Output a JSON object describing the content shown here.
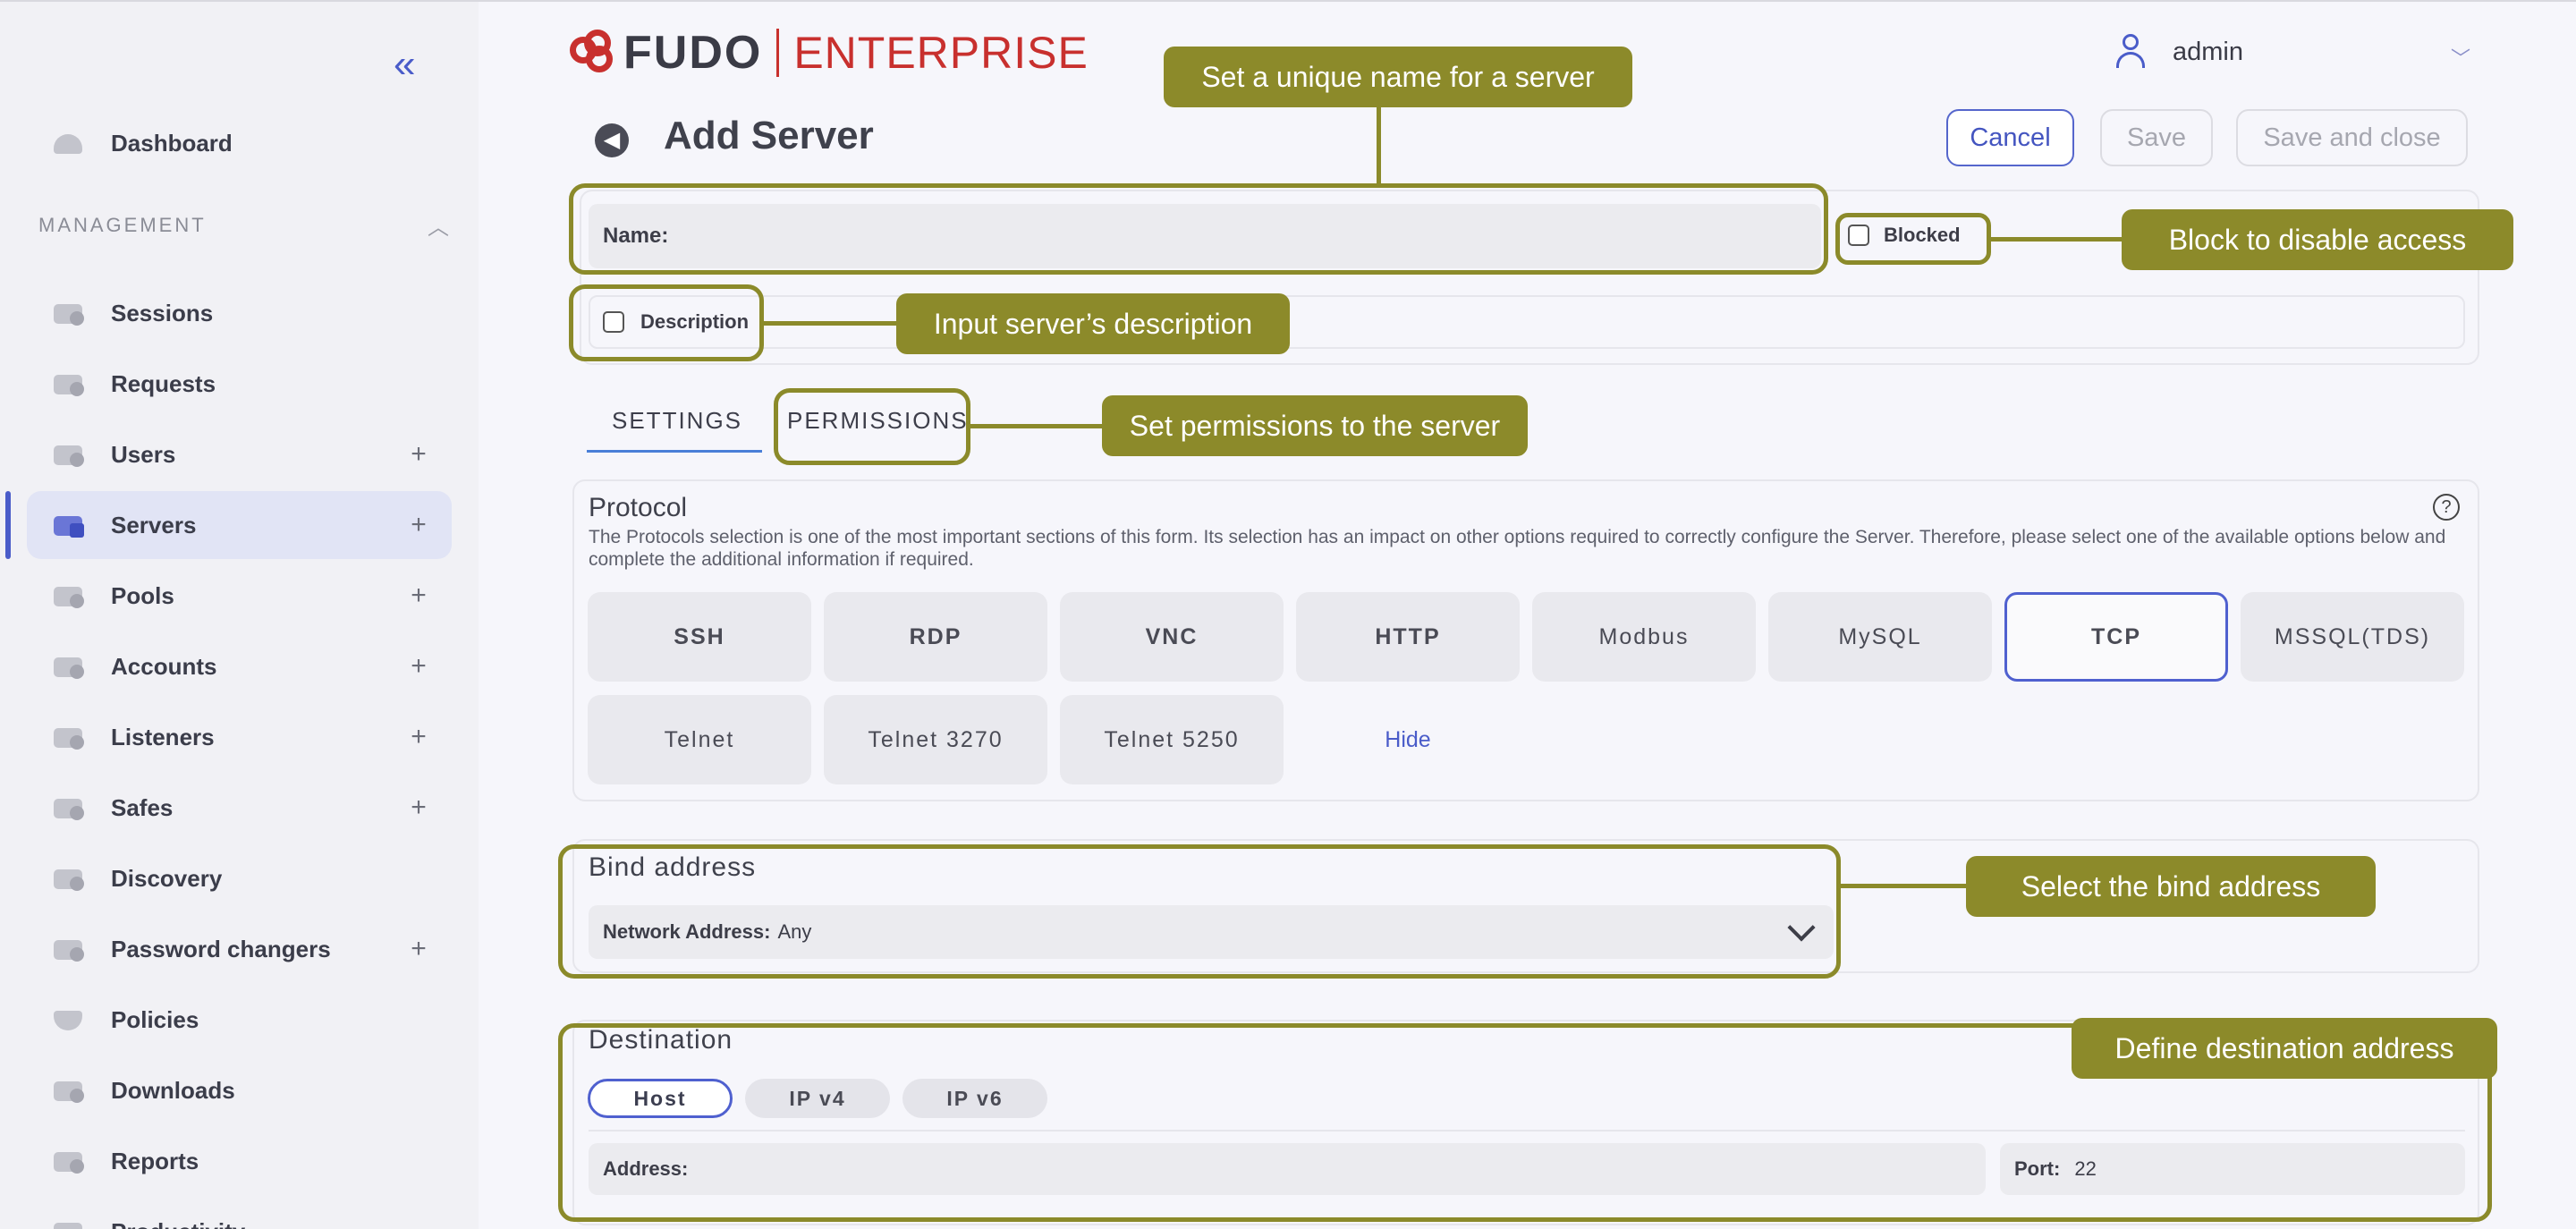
{
  "sidebar": {
    "collapse_icon": "double-chevron-left-icon",
    "dashboard": "Dashboard",
    "section_label": "MANAGEMENT",
    "items": [
      {
        "label": "Sessions",
        "icon": "sessions-icon",
        "add": ""
      },
      {
        "label": "Requests",
        "icon": "requests-icon",
        "add": ""
      },
      {
        "label": "Users",
        "icon": "users-icon",
        "add": "+"
      },
      {
        "label": "Servers",
        "icon": "servers-icon",
        "add": "+"
      },
      {
        "label": "Pools",
        "icon": "pools-icon",
        "add": "+"
      },
      {
        "label": "Accounts",
        "icon": "accounts-icon",
        "add": "+"
      },
      {
        "label": "Listeners",
        "icon": "listeners-icon",
        "add": "+"
      },
      {
        "label": "Safes",
        "icon": "safes-icon",
        "add": "+"
      },
      {
        "label": "Discovery",
        "icon": "discovery-icon",
        "add": ""
      },
      {
        "label": "Password changers",
        "icon": "password-changers-icon",
        "add": "+"
      },
      {
        "label": "Policies",
        "icon": "policies-icon",
        "add": ""
      },
      {
        "label": "Downloads",
        "icon": "downloads-icon",
        "add": ""
      },
      {
        "label": "Reports",
        "icon": "reports-icon",
        "add": ""
      },
      {
        "label": "Productivity",
        "icon": "productivity-icon",
        "add": ""
      }
    ],
    "active": "Servers"
  },
  "header": {
    "logo_primary": "FUDO",
    "logo_secondary": "ENTERPRISE",
    "user_name": "admin",
    "page_title": "Add Server",
    "cancel_label": "Cancel",
    "save_label": "Save",
    "save_close_label": "Save and close"
  },
  "form": {
    "name_label": "Name:",
    "blocked_label": "Blocked",
    "description_label": "Description",
    "tabs": [
      "SETTINGS",
      "PERMISSIONS"
    ],
    "protocol": {
      "title": "Protocol",
      "description": "The Protocols selection is one of the most important sections of this form. Its selection has an impact on other options required to correctly configure the Server. Therefore, please select one of the available options below and complete the additional information if required.",
      "options": [
        "SSH",
        "RDP",
        "VNC",
        "HTTP",
        "Modbus",
        "MySQL",
        "TCP",
        "MSSQL(TDS)",
        "Telnet",
        "Telnet 3270",
        "Telnet 5250"
      ],
      "selected": "TCP",
      "hide_label": "Hide"
    },
    "bind": {
      "title": "Bind address",
      "network_label": "Network Address:",
      "network_value": "Any"
    },
    "destination": {
      "title": "Destination",
      "options": [
        "Host",
        "IP v4",
        "IP v6"
      ],
      "selected": "Host",
      "address_label": "Address:",
      "port_label": "Port:",
      "port_value": "22"
    }
  },
  "annotations": {
    "name": "Set a unique name for a server",
    "blocked": "Block to disable access",
    "description": "Input server’s description",
    "permissions": "Set permissions to the server",
    "bind": "Select the bind address",
    "destination": "Define destination address",
    "color": "#8c8a2a"
  }
}
